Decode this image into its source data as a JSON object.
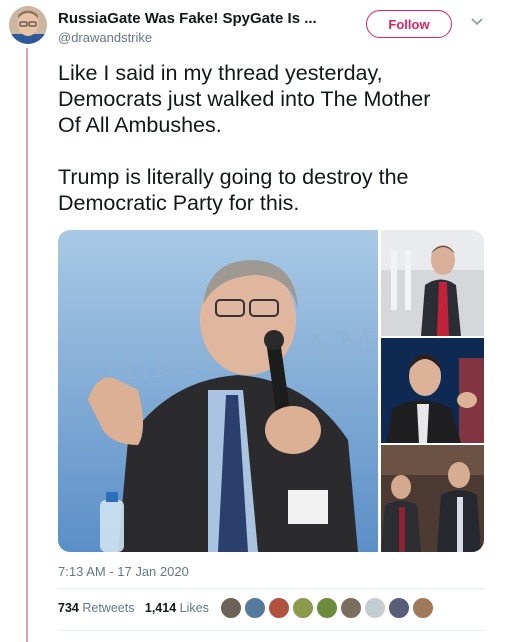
{
  "user": {
    "display_name": "RussiaGate Was Fake! SpyGate Is ...",
    "handle": "@drawandstrike"
  },
  "follow_label": "Follow",
  "tweet": {
    "text": "Like I said in my thread yesterday,\nDemocrats just walked into The Mother\nOf All Ambushes.\n\nTrump is literally going to destroy the\nDemocratic Party for this."
  },
  "media": {
    "main_sign_text": "THE JERUSA      M  PO"
  },
  "timestamp": "7:13 AM - 17 Jan 2020",
  "stats": {
    "retweets_count": "734",
    "retweets_label": "Retweets",
    "likes_count": "1,414",
    "likes_label": "Likes"
  },
  "colors": {
    "accent": "#e0245e",
    "thread_line": "#e0a3ad",
    "secondary_text": "#657786"
  },
  "icons": [
    "chevron-down-icon"
  ]
}
